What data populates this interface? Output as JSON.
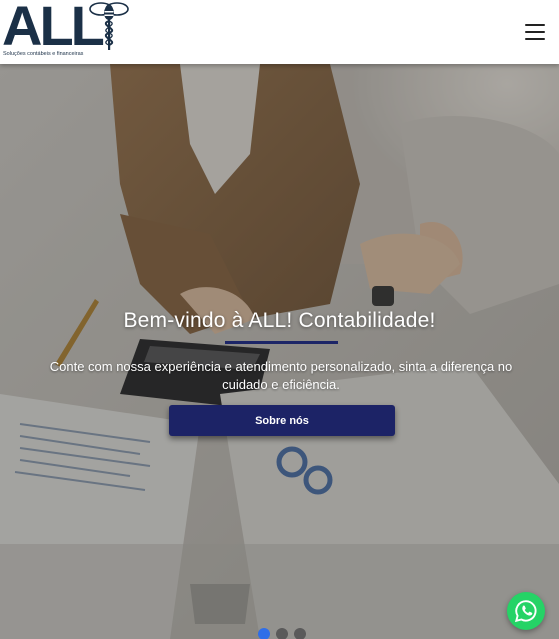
{
  "header": {
    "logo_text": "ALL",
    "logo_tagline": "Soluções contábeis e financeiras",
    "menu_icon": "hamburger-menu-icon"
  },
  "hero": {
    "title": "Bem-vindo à ALL! Contabilidade!",
    "subtitle": "Conte com nossa experiência e atendimento personalizado, sinta a diferença no cuidado e eficiência.",
    "button_label": "Sobre nós",
    "slides_count": 3,
    "active_slide": 1
  },
  "floating": {
    "whatsapp_icon": "whatsapp-icon"
  },
  "colors": {
    "brand_navy": "#1c2366",
    "logo_color": "#1b3047",
    "whatsapp_green": "#25d366",
    "active_dot": "#2f6ee8"
  }
}
